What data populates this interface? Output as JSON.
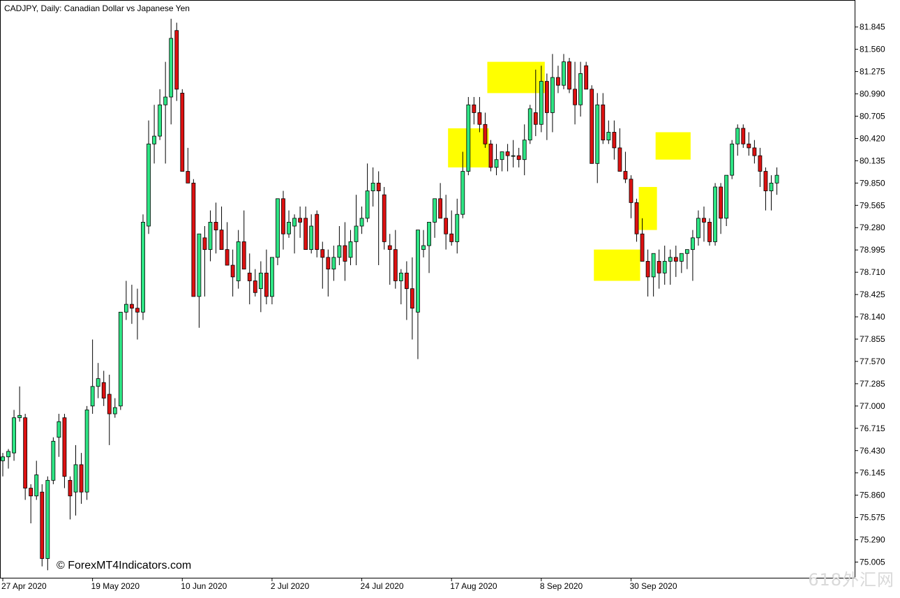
{
  "chart_title": "CADJPY, Daily:  Canadian Dollar vs Japanese Yen",
  "copyright": "© ForexMT4Indicators.com",
  "watermark": "618外汇网",
  "colors": {
    "bull": "#2ee584",
    "bear": "#dd1111",
    "wick": "#000000",
    "highlight": "#ffff00",
    "axis": "#000000",
    "background": "#ffffff"
  },
  "chart_data": {
    "type": "candlestick",
    "title": "CADJPY, Daily:  Canadian Dollar vs Japanese Yen",
    "ylim": [
      74.84,
      81.985
    ],
    "y_ticks": [
      "81.845",
      "81.560",
      "81.275",
      "80.990",
      "80.705",
      "80.420",
      "80.135",
      "79.850",
      "79.565",
      "79.280",
      "78.995",
      "78.710",
      "78.425",
      "78.140",
      "77.855",
      "77.570",
      "77.285",
      "77.000",
      "76.715",
      "76.430",
      "76.145",
      "75.860",
      "75.575",
      "75.290",
      "75.005"
    ],
    "x_labels": [
      {
        "index": 0,
        "label": "27 Apr 2020"
      },
      {
        "index": 16,
        "label": "19 May 2020"
      },
      {
        "index": 32,
        "label": "10 Jun 2020"
      },
      {
        "index": 48,
        "label": "2 Jul 2020"
      },
      {
        "index": 64,
        "label": "24 Jul 2020"
      },
      {
        "index": 80,
        "label": "17 Aug 2020"
      },
      {
        "index": 96,
        "label": "8 Sep 2020"
      },
      {
        "index": 112,
        "label": "30 Sep 2020"
      }
    ],
    "candles": [
      [
        76.3,
        76.4,
        76.1,
        76.35
      ],
      [
        76.35,
        76.45,
        76.2,
        76.42
      ],
      [
        76.4,
        76.95,
        76.3,
        76.85
      ],
      [
        76.85,
        77.25,
        76.8,
        76.88
      ],
      [
        76.85,
        76.9,
        75.8,
        75.95
      ],
      [
        75.95,
        76.0,
        75.5,
        75.85
      ],
      [
        75.85,
        76.3,
        75.8,
        76.12
      ],
      [
        75.9,
        76.0,
        74.95,
        75.05
      ],
      [
        75.05,
        76.1,
        74.9,
        76.05
      ],
      [
        76.05,
        76.6,
        76.0,
        76.55
      ],
      [
        76.6,
        76.9,
        76.35,
        76.8
      ],
      [
        76.85,
        76.9,
        75.95,
        76.1
      ],
      [
        76.05,
        76.1,
        75.55,
        75.85
      ],
      [
        75.9,
        76.5,
        75.6,
        76.25
      ],
      [
        76.25,
        76.4,
        75.75,
        75.9
      ],
      [
        75.9,
        77.0,
        75.8,
        76.95
      ],
      [
        77.0,
        77.85,
        76.9,
        77.25
      ],
      [
        77.25,
        77.55,
        77.1,
        77.35
      ],
      [
        77.3,
        77.45,
        77.0,
        77.1
      ],
      [
        77.15,
        77.4,
        76.5,
        76.9
      ],
      [
        76.9,
        77.1,
        76.85,
        76.98
      ],
      [
        77.0,
        78.2,
        76.95,
        78.2
      ],
      [
        78.2,
        78.6,
        78.1,
        78.3
      ],
      [
        78.3,
        78.55,
        78.05,
        78.25
      ],
      [
        78.25,
        78.5,
        77.85,
        78.2
      ],
      [
        78.2,
        79.45,
        78.1,
        79.35
      ],
      [
        79.3,
        80.65,
        79.2,
        80.35
      ],
      [
        80.35,
        80.85,
        80.1,
        80.45
      ],
      [
        80.45,
        81.05,
        80.4,
        80.85
      ],
      [
        80.85,
        81.4,
        80.1,
        80.95
      ],
      [
        80.95,
        81.95,
        80.6,
        81.7
      ],
      [
        81.8,
        81.9,
        80.9,
        81.05
      ],
      [
        81.0,
        81.05,
        80.05,
        80.0
      ],
      [
        80.0,
        80.3,
        79.85,
        79.85
      ],
      [
        79.85,
        79.9,
        78.5,
        78.4
      ],
      [
        78.4,
        79.0,
        78.0,
        79.2
      ],
      [
        79.15,
        79.3,
        78.4,
        79.0
      ],
      [
        79.0,
        79.5,
        78.85,
        79.35
      ],
      [
        79.35,
        79.6,
        78.95,
        79.25
      ],
      [
        79.25,
        79.55,
        79.0,
        79.0
      ],
      [
        79.0,
        79.35,
        78.85,
        78.8
      ],
      [
        78.8,
        79.0,
        78.4,
        78.65
      ],
      [
        78.6,
        79.25,
        78.5,
        79.1
      ],
      [
        79.1,
        79.5,
        78.9,
        78.75
      ],
      [
        78.7,
        78.95,
        78.3,
        78.6
      ],
      [
        78.6,
        78.75,
        78.4,
        78.45
      ],
      [
        78.5,
        78.85,
        78.2,
        78.7
      ],
      [
        78.7,
        79.0,
        78.3,
        78.4
      ],
      [
        78.4,
        78.75,
        78.3,
        78.9
      ],
      [
        78.9,
        79.45,
        78.8,
        79.65
      ],
      [
        79.65,
        79.75,
        79.0,
        79.2
      ],
      [
        79.2,
        79.5,
        79.15,
        79.35
      ],
      [
        79.3,
        79.45,
        78.95,
        79.4
      ],
      [
        79.4,
        79.55,
        79.15,
        79.35
      ],
      [
        79.4,
        79.55,
        79.1,
        79.0
      ],
      [
        79.0,
        79.45,
        78.95,
        79.3
      ],
      [
        79.45,
        79.5,
        78.9,
        79.0
      ],
      [
        79.0,
        79.1,
        78.5,
        78.9
      ],
      [
        78.9,
        79.0,
        78.4,
        78.75
      ],
      [
        78.75,
        79.05,
        78.6,
        78.9
      ],
      [
        78.9,
        79.3,
        78.8,
        79.05
      ],
      [
        79.05,
        79.35,
        78.6,
        78.85
      ],
      [
        78.9,
        79.25,
        78.8,
        79.1
      ],
      [
        79.1,
        79.7,
        78.8,
        79.3
      ],
      [
        79.3,
        79.55,
        79.2,
        79.4
      ],
      [
        79.4,
        80.1,
        79.35,
        79.75
      ],
      [
        79.75,
        80.05,
        79.55,
        79.85
      ],
      [
        79.85,
        80.0,
        78.8,
        79.75
      ],
      [
        79.7,
        79.8,
        79.0,
        79.1
      ],
      [
        79.05,
        79.2,
        78.55,
        79.0
      ],
      [
        79.0,
        79.25,
        78.5,
        78.6
      ],
      [
        78.6,
        78.75,
        78.3,
        78.7
      ],
      [
        78.7,
        78.85,
        78.1,
        78.5
      ],
      [
        78.5,
        78.9,
        77.85,
        78.25
      ],
      [
        78.2,
        79.0,
        77.6,
        79.25
      ],
      [
        79.0,
        79.25,
        78.9,
        79.05
      ],
      [
        79.05,
        79.35,
        78.7,
        79.35
      ],
      [
        79.35,
        79.65,
        79.15,
        79.65
      ],
      [
        79.65,
        79.85,
        79.4,
        79.4
      ],
      [
        79.4,
        79.7,
        79.0,
        79.2
      ],
      [
        79.2,
        79.5,
        79.05,
        79.1
      ],
      [
        79.1,
        79.65,
        78.95,
        79.45
      ],
      [
        79.45,
        80.25,
        79.4,
        80.0
      ],
      [
        80.0,
        80.95,
        79.95,
        80.85
      ],
      [
        80.85,
        80.95,
        80.6,
        80.75
      ],
      [
        80.75,
        80.95,
        80.5,
        80.6
      ],
      [
        80.6,
        80.75,
        80.3,
        80.35
      ],
      [
        80.35,
        80.4,
        80.0,
        80.05
      ],
      [
        80.05,
        80.35,
        79.95,
        80.15
      ],
      [
        80.15,
        80.25,
        80.0,
        80.25
      ],
      [
        80.25,
        80.35,
        80.0,
        80.2
      ],
      [
        80.2,
        80.4,
        80.05,
        80.2
      ],
      [
        80.2,
        80.3,
        80.05,
        80.15
      ],
      [
        80.15,
        80.6,
        79.95,
        80.4
      ],
      [
        80.4,
        80.85,
        80.35,
        80.8
      ],
      [
        80.75,
        81.3,
        80.45,
        80.6
      ],
      [
        80.6,
        81.35,
        80.5,
        81.15
      ],
      [
        81.15,
        81.25,
        80.4,
        80.75
      ],
      [
        80.75,
        81.5,
        80.5,
        81.2
      ],
      [
        81.2,
        81.35,
        81.0,
        81.1
      ],
      [
        81.1,
        81.5,
        81.05,
        81.4
      ],
      [
        81.4,
        81.45,
        81.0,
        81.05
      ],
      [
        81.05,
        81.4,
        80.6,
        80.85
      ],
      [
        80.85,
        81.4,
        80.7,
        81.25
      ],
      [
        81.35,
        81.4,
        81.1,
        81.05
      ],
      [
        81.05,
        81.1,
        80.2,
        80.1
      ],
      [
        80.1,
        81.0,
        79.85,
        80.85
      ],
      [
        80.85,
        81.0,
        80.35,
        80.4
      ],
      [
        80.4,
        80.65,
        80.35,
        80.5
      ],
      [
        80.5,
        80.65,
        80.15,
        80.3
      ],
      [
        80.3,
        80.55,
        80.1,
        80.0
      ],
      [
        80.0,
        80.25,
        79.85,
        79.9
      ],
      [
        79.9,
        79.95,
        79.4,
        79.6
      ],
      [
        79.6,
        79.65,
        79.1,
        79.2
      ],
      [
        79.2,
        79.4,
        78.9,
        78.85
      ],
      [
        78.85,
        79.0,
        78.4,
        78.65
      ],
      [
        78.65,
        78.8,
        78.4,
        78.95
      ],
      [
        78.85,
        79.0,
        78.5,
        78.7
      ],
      [
        78.7,
        79.05,
        78.55,
        78.85
      ],
      [
        78.85,
        79.0,
        78.55,
        78.9
      ],
      [
        78.9,
        79.05,
        78.65,
        78.85
      ],
      [
        78.85,
        78.95,
        78.7,
        78.95
      ],
      [
        78.95,
        79.0,
        78.75,
        79.0
      ],
      [
        79.0,
        79.25,
        78.6,
        79.15
      ],
      [
        79.15,
        79.5,
        79.05,
        79.4
      ],
      [
        79.4,
        79.55,
        79.1,
        79.35
      ],
      [
        79.35,
        79.4,
        79.05,
        79.1
      ],
      [
        79.1,
        79.85,
        79.05,
        79.8
      ],
      [
        79.8,
        79.85,
        79.2,
        79.4
      ],
      [
        79.4,
        79.95,
        79.3,
        79.95
      ],
      [
        79.95,
        80.4,
        79.9,
        80.35
      ],
      [
        80.35,
        80.6,
        80.2,
        80.55
      ],
      [
        80.55,
        80.6,
        80.3,
        80.35
      ],
      [
        80.35,
        80.5,
        80.2,
        80.3
      ],
      [
        80.3,
        80.4,
        80.1,
        80.2
      ],
      [
        80.2,
        80.3,
        79.8,
        80.0
      ],
      [
        80.0,
        80.05,
        79.5,
        79.75
      ],
      [
        79.75,
        79.95,
        79.5,
        79.85
      ],
      [
        79.85,
        80.05,
        79.7,
        79.95
      ]
    ],
    "highlight_zones": [
      {
        "from_index": 80,
        "to_index": 86,
        "y_low": 80.05,
        "y_high": 80.55
      },
      {
        "from_index": 87,
        "to_index": 96,
        "y_low": 81.0,
        "y_high": 81.4
      },
      {
        "from_index": 106,
        "to_index": 113,
        "y_low": 78.6,
        "y_high": 79.0
      },
      {
        "from_index": 114,
        "to_index": 116,
        "y_low": 79.25,
        "y_high": 79.8
      },
      {
        "from_index": 117,
        "to_index": 122,
        "y_low": 80.15,
        "y_high": 80.5
      }
    ]
  }
}
